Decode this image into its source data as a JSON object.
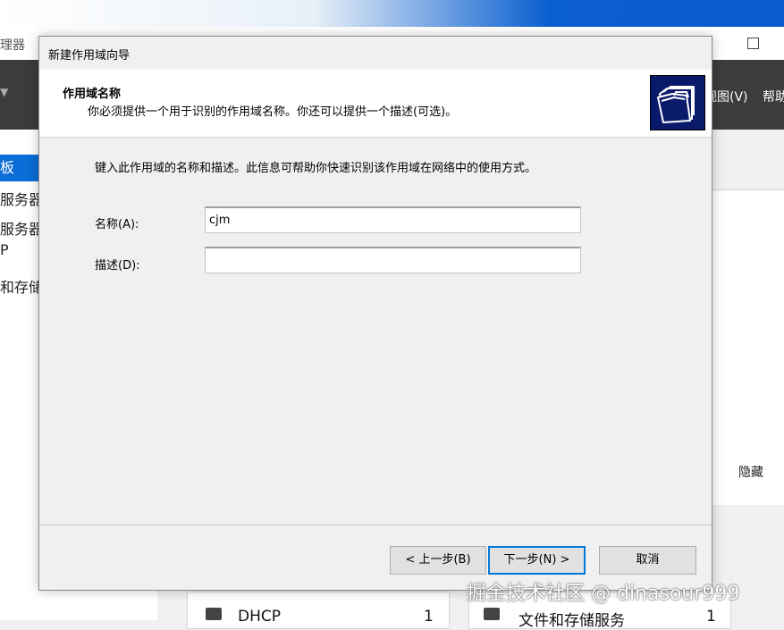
{
  "background": {
    "app_title_fragment": "理器",
    "menu_view": "视图(V)",
    "menu_help": "帮助",
    "sidebar_items": [
      "仪表板",
      "本地服务器",
      "所有服务器",
      "DHCP",
      "文件和存储服务"
    ],
    "sidebar_visible": [
      "板",
      "服务器",
      "服务器",
      "P",
      "和存储"
    ],
    "hide_link": "隐藏",
    "tiles": [
      {
        "label": "DHCP",
        "count": "1"
      },
      {
        "label": "文件和存储服务",
        "count": "1"
      }
    ]
  },
  "dialog": {
    "title": "新建作用域向导",
    "heading": "作用域名称",
    "subheading": "你必须提供一个用于识别的作用域名称。你还可以提供一个描述(可选)。",
    "instruction": "键入此作用域的名称和描述。此信息可帮助你快速识别该作用域在网络中的使用方式。",
    "name_label": "名称(A):",
    "name_value": "cjm",
    "description_label": "描述(D):",
    "description_value": "",
    "buttons": {
      "back": "< 上一步(B)",
      "next": "下一步(N) >",
      "cancel": "取消"
    }
  },
  "watermark": "掘金技术社区 @ dinasour999",
  "icons": [
    "folder-stack-icon",
    "dropdown-arrow-icon",
    "dhcp-tile-icon",
    "file-storage-tile-icon"
  ],
  "colors": {
    "accent_blue": "#0078d7",
    "toolbar_dark": "#3c3c3c",
    "selected_item": "#0a6cd6",
    "icon_bg": "#0a1a6b"
  }
}
